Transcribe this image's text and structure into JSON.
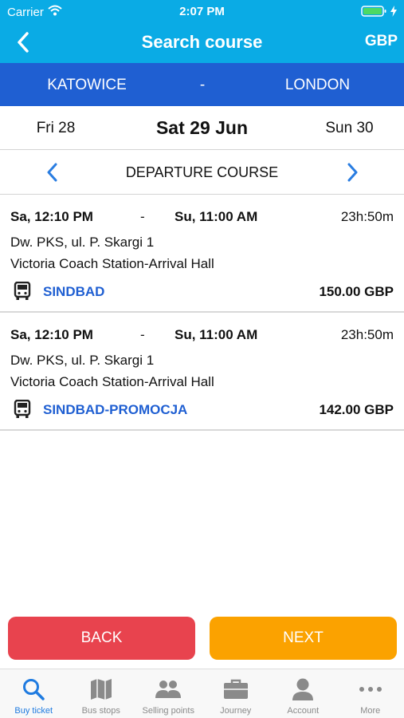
{
  "status": {
    "carrier": "Carrier",
    "time": "2:07 PM"
  },
  "nav": {
    "title": "Search course",
    "currency": "GBP"
  },
  "route": {
    "from": "KATOWICE",
    "separator": "-",
    "to": "LONDON"
  },
  "dates": {
    "prev": "Fri 28",
    "current": "Sat 29 Jun",
    "next": "Sun 30"
  },
  "course": {
    "label": "DEPARTURE COURSE"
  },
  "trips": [
    {
      "departure": "Sa, 12:10 PM",
      "separator": "-",
      "arrival": "Su, 11:00 AM",
      "duration": "23h:50m",
      "from_station": "Dw. PKS, ul. P. Skargi 1",
      "to_station": "Victoria Coach Station-Arrival Hall",
      "carrier": "SINDBAD",
      "price": "150.00 GBP"
    },
    {
      "departure": "Sa, 12:10 PM",
      "separator": "-",
      "arrival": "Su, 11:00 AM",
      "duration": "23h:50m",
      "from_station": "Dw. PKS, ul. P. Skargi 1",
      "to_station": "Victoria Coach Station-Arrival Hall",
      "carrier": "SINDBAD-PROMOCJA",
      "price": "142.00 GBP"
    }
  ],
  "buttons": {
    "back": "BACK",
    "next": "NEXT"
  },
  "tabs": [
    {
      "label": "Buy ticket",
      "icon": "search-icon",
      "active": true
    },
    {
      "label": "Bus stops",
      "icon": "map-icon",
      "active": false
    },
    {
      "label": "Selling points",
      "icon": "people-icon",
      "active": false
    },
    {
      "label": "Journey",
      "icon": "briefcase-icon",
      "active": false
    },
    {
      "label": "Account",
      "icon": "person-icon",
      "active": false
    },
    {
      "label": "More",
      "icon": "more-icon",
      "active": false
    }
  ],
  "colors": {
    "header": "#0aabe5",
    "route_bar": "#1f5fd2",
    "carrier_text": "#1f5fd2",
    "back_button": "#e8434e",
    "next_button": "#fba200",
    "tab_active": "#1f7be0",
    "tab_inactive": "#8a8a8a"
  }
}
